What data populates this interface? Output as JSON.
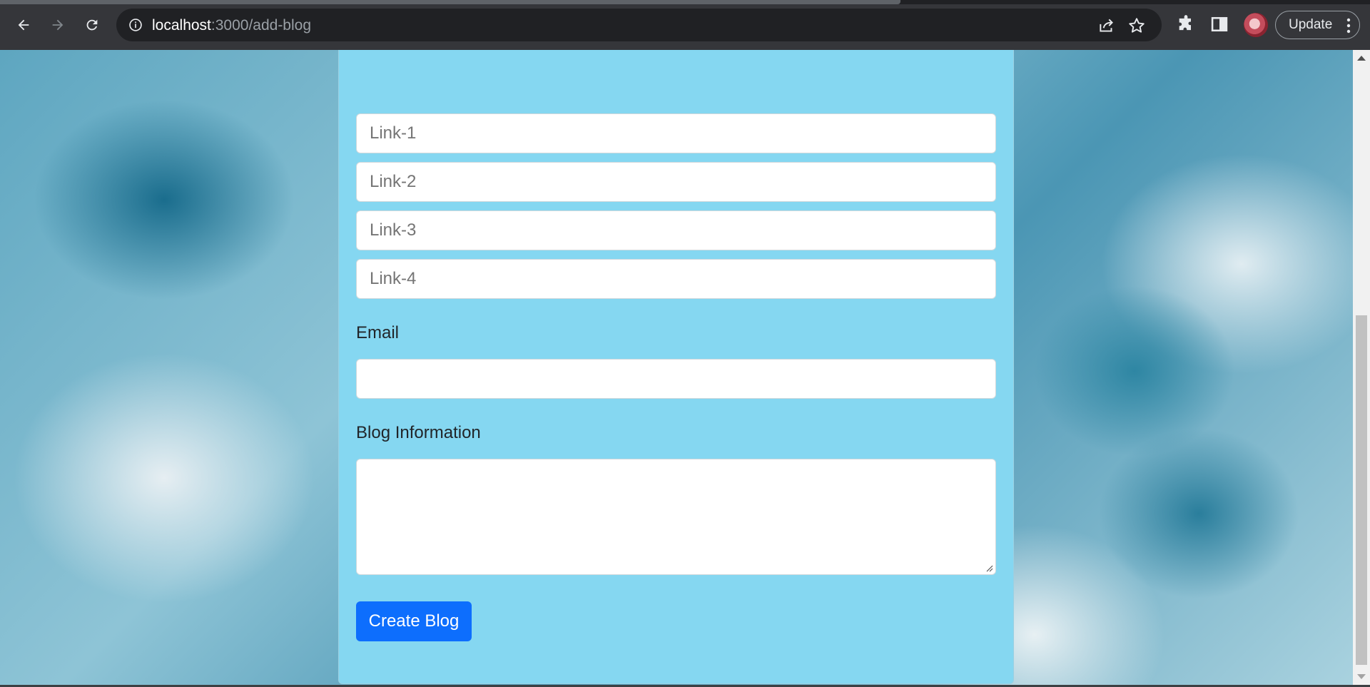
{
  "browser": {
    "url_host": "localhost",
    "url_path": ":3000/add-blog",
    "update_label": "Update"
  },
  "form": {
    "links": [
      {
        "placeholder": "Link-1"
      },
      {
        "placeholder": "Link-2"
      },
      {
        "placeholder": "Link-3"
      },
      {
        "placeholder": "Link-4"
      }
    ],
    "email_label": "Email",
    "email_value": "",
    "blog_info_label": "Blog Information",
    "blog_info_value": "",
    "submit_label": "Create Blog"
  },
  "colors": {
    "card_background": "#85d7f1",
    "button_primary": "#0d6efd"
  },
  "icons": [
    "back-icon",
    "forward-icon",
    "reload-icon",
    "info-icon",
    "share-icon",
    "star-icon",
    "extensions-icon",
    "side-panel-icon",
    "more-vert-icon"
  ]
}
